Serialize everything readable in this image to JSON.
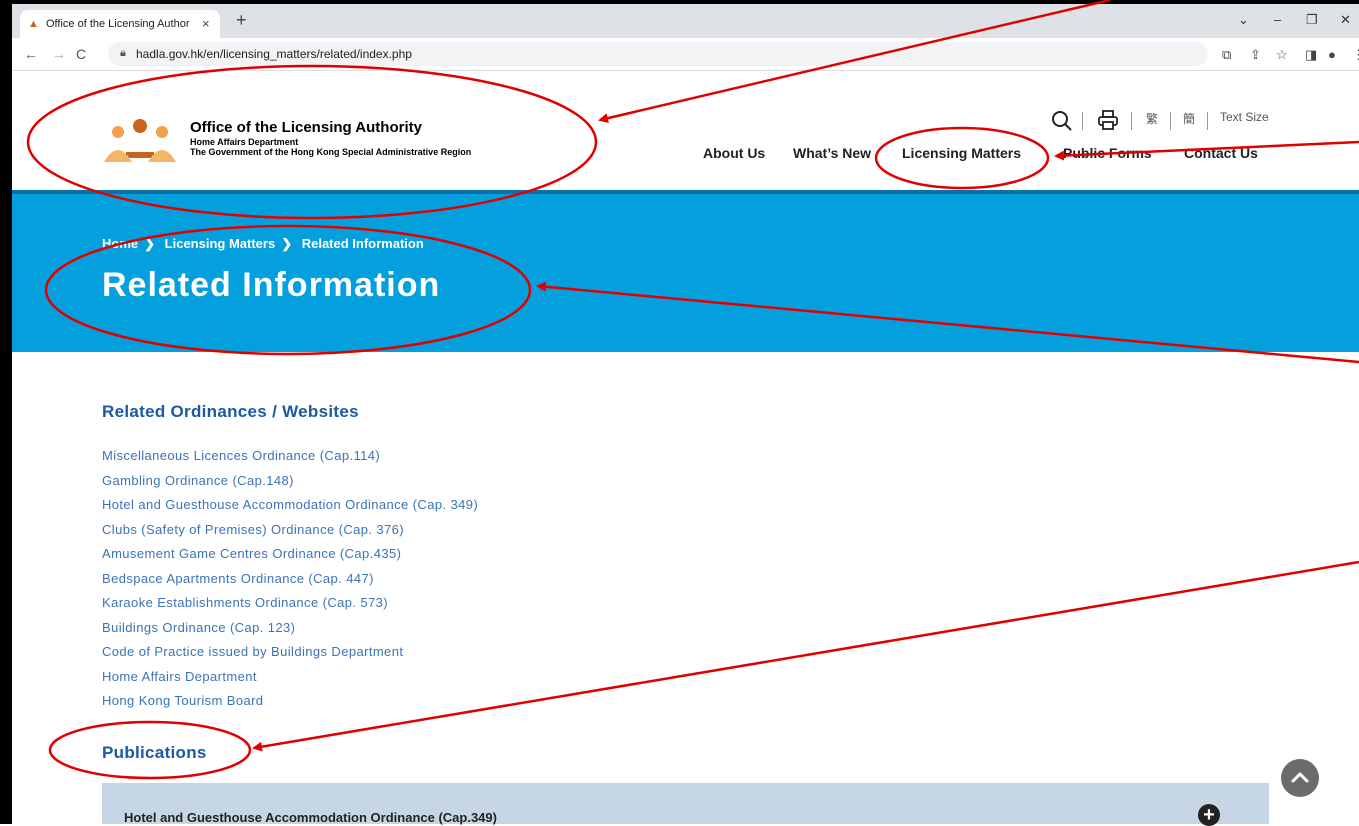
{
  "browser": {
    "tab_title": "Office of the Licensing Author",
    "tab_close": "×",
    "new_tab": "+",
    "url": "hadla.gov.hk/en/licensing_matters/related/index.php",
    "window_controls": [
      "⌄",
      "–",
      "❐",
      "✕"
    ],
    "nav": {
      "back": "←",
      "forward": "→",
      "reload": "C"
    }
  },
  "header": {
    "org_name": "Office of the Licensing Authority",
    "dept": "Home Affairs Department",
    "gov": "The Government of the Hong Kong Special Administrative Region",
    "tools": {
      "trad": "繁",
      "simp": "簡",
      "text_size": "Text Size"
    },
    "nav": [
      "About Us",
      "What’s New",
      "Licensing Matters",
      "Public Forms",
      "Contact Us"
    ]
  },
  "banner": {
    "breadcrumb": [
      "Home",
      "Licensing Matters",
      "Related Information"
    ],
    "title": "Related Information"
  },
  "content": {
    "section1_title": "Related Ordinances / Websites",
    "links": [
      "Miscellaneous Licences Ordinance (Cap.114)",
      "Gambling Ordinance (Cap.148)",
      "Hotel and Guesthouse Accommodation Ordinance (Cap. 349)",
      "Clubs (Safety of Premises) Ordinance (Cap. 376)",
      "Amusement Game Centres Ordinance (Cap.435)",
      "Bedspace Apartments Ordinance (Cap. 447)",
      "Karaoke Establishments Ordinance (Cap. 573)",
      "Buildings Ordinance (Cap. 123)",
      "Code of Practice issued by Buildings Department",
      "Home Affairs Department",
      "Hong Kong Tourism Board"
    ],
    "section2_title": "Publications",
    "accordion_item": "Hotel and Guesthouse Accommodation Ordinance (Cap.349)"
  },
  "colors": {
    "banner": "#049fdd",
    "heading": "#1b5aa5",
    "link": "#3b73b9",
    "annotation": "#e00000"
  }
}
